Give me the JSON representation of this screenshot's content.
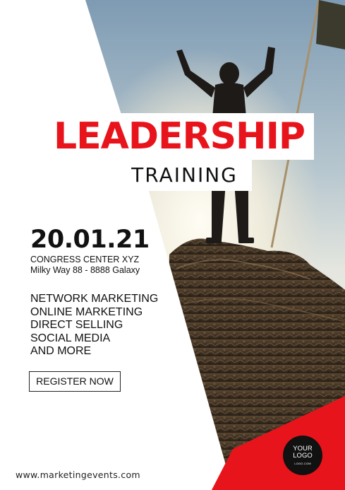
{
  "colors": {
    "accent": "#e8141c",
    "text": "#111111",
    "background": "#ffffff"
  },
  "header": {
    "title": "LEADERSHIP",
    "subtitle": "TRAINING"
  },
  "event": {
    "date": "20.01.21",
    "venue": "CONGRESS CENTER XYZ",
    "address": "Milky Way 88 - 8888 Galaxy"
  },
  "topics": [
    "NETWORK MARKETING",
    "ONLINE MARKETING",
    "DIRECT SELLING",
    "SOCIAL MEDIA",
    "AND MORE"
  ],
  "cta": {
    "register_label": "REGISTER NOW"
  },
  "footer": {
    "website": "www.marketingevents.com"
  },
  "logo": {
    "line1": "YOUR",
    "line2": "LOGO",
    "line3": "LOGO.COM"
  },
  "icons": {
    "logo": "logo-circle-icon",
    "flag": "flag-icon"
  }
}
